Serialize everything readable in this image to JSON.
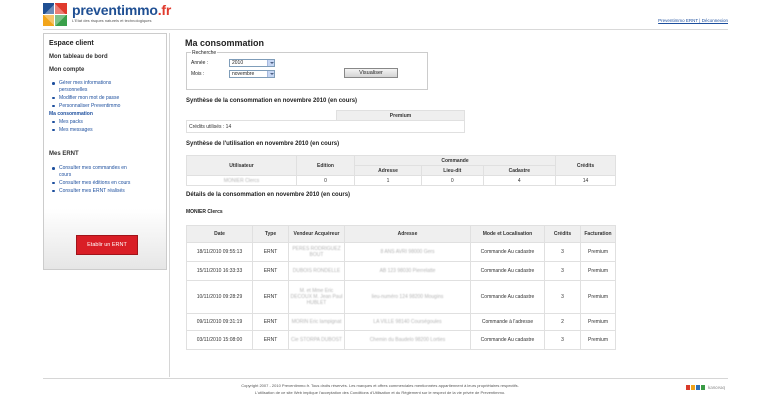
{
  "brand": {
    "name": "preventimmo",
    "tld": ".fr",
    "tagline": "L'Etat des risques naturels et technologiques"
  },
  "top_links": "Preventimmo ERNT | Déconnexion",
  "sidebar": {
    "title": "Espace client",
    "dashboard": "Mon tableau de bord",
    "account_title": "Mon compte",
    "account_items": [
      "Gérer mes informations personnelles",
      "Modifier mon mot de passe",
      "Personnaliser Preventimmo"
    ],
    "consumption": "Ma consommation",
    "sub_items": [
      "Mes packs",
      "Mes messages"
    ],
    "ernt_title": "Mes ERNT",
    "ernt_items": [
      "Consulter mes commandes en cours",
      "Consulter mes éditions en cours",
      "Consulter mes ERNT réalisés"
    ],
    "cta": "Etablir un ERNT"
  },
  "main": {
    "title": "Ma consommation",
    "search": {
      "legend": "Recherche",
      "year_label": "Année :",
      "year_value": "2010",
      "month_label": "Mois :",
      "month_value": "novembre",
      "button": "Visualiser"
    },
    "synth_title": "Synthèse de la consommation en novembre 2010 (en cours)",
    "synth_header": "Premium",
    "synth_row": "Crédits utilisés : 14",
    "usage_title": "Synthèse de l'utilisation en novembre 2010 (en cours)",
    "usage_headers": {
      "user": "Utilisateur",
      "edition": "Edition",
      "commande": "Commande",
      "credits": "Crédits",
      "adresse": "Adresse",
      "lieudit": "Lieu-dit",
      "cadastre": "Cadastre"
    },
    "usage_row": {
      "user": "MONIER Clercs",
      "edition": "0",
      "adresse": "1",
      "lieudit": "0",
      "cadastre": "4",
      "credits": "14"
    },
    "details_title": "Détails de la consommation en novembre 2010 (en cours)",
    "details_user": "MONIER Clercs",
    "details_headers": [
      "Date",
      "Type",
      "Vendeur Acquéreur",
      "Adresse",
      "Mode et Localisation",
      "Crédits",
      "Facturation"
    ],
    "details_rows": [
      {
        "date": "18/11/2010 09:55:13",
        "type": "ERNT",
        "vendeur": "PERES RODRIGUEZ BOUT",
        "adresse": "8 ANS AVRI 98000 Gers",
        "mode": "Commande Au cadastre",
        "credits": "3",
        "fact": "Premium"
      },
      {
        "date": "15/11/2010 16:33:33",
        "type": "ERNT",
        "vendeur": "DUBOIS RONDELLE",
        "adresse": "AB 123 98030 Pierrelatte",
        "mode": "Commande Au cadastre",
        "credits": "3",
        "fact": "Premium"
      },
      {
        "date": "10/11/2010 09:28:29",
        "type": "ERNT",
        "vendeur": "M. et Mme Eric DECOUX M. Jean Paul HUBLET",
        "adresse": "lieu-numéro 124 98200 Mougins",
        "mode": "Commande Au cadastre",
        "credits": "3",
        "fact": "Premium"
      },
      {
        "date": "09/11/2010 09:31:19",
        "type": "ERNT",
        "vendeur": "MORIN Eric lampignat",
        "adresse": "LA VILLE 98140 Courségoules",
        "mode": "Commande à l'adresse",
        "credits": "2",
        "fact": "Premium"
      },
      {
        "date": "03/11/2010 15:08:00",
        "type": "ERNT",
        "vendeur": "Cie STORPA DUBOST",
        "adresse": "Chemin du Baudelo 98200 Lorties",
        "mode": "Commande Au cadastre",
        "credits": "3",
        "fact": "Premium"
      }
    ]
  },
  "footer": {
    "line1": "Copyright 2007 - 2010 Preventimmo.fr. Tous droits réservés. Les marques et offres commerciales mentionnées appartiennent à leurs propriétaires respectifs.",
    "line2": "L'utilisation de ce site Web implique l'acceptation des Conditions d'Utilisation et du Règlement sur le respect de la vie privée de Preventimmo.",
    "partner": "kanceaq"
  },
  "colors": {
    "brand_blue": "#1f4f93",
    "accent_red": "#d91e26",
    "link": "#1d4f9e"
  }
}
